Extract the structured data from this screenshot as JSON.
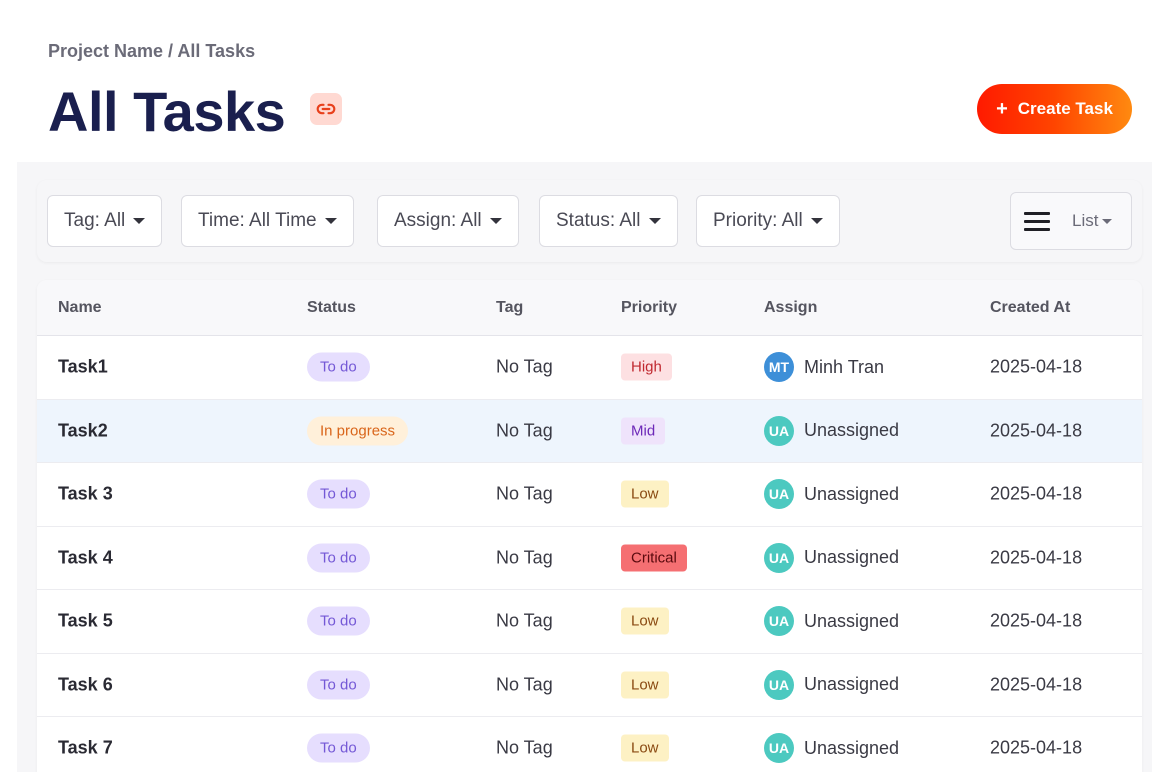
{
  "breadcrumb": "Project Name / All Tasks",
  "title": "All Tasks",
  "create_button": {
    "icon": "+",
    "label": "Create Task"
  },
  "colors": {
    "title": "#1a1f4e",
    "create_gradient_start": "#ff1a00",
    "create_gradient_end": "#ff8a10",
    "row_highlight": "#eef5fd"
  },
  "filters": [
    {
      "label": "Tag: All"
    },
    {
      "label": "Time: All Time"
    },
    {
      "label": "Assign: All"
    },
    {
      "label": "Status: All"
    },
    {
      "label": "Priority: All"
    }
  ],
  "view_toggle": {
    "icon": "hamburger-icon",
    "label": "List"
  },
  "table": {
    "headers": [
      "Name",
      "Status",
      "Tag",
      "Priority",
      "Assign",
      "Created At"
    ],
    "rows": [
      {
        "name": "Task1",
        "status": "To do",
        "tag": "No Tag",
        "priority": "High",
        "assign_initials": "MT",
        "assign_name": "Minh Tran",
        "created_at": "2025-04-18"
      },
      {
        "name": "Task2",
        "status": "In progress",
        "tag": "No Tag",
        "priority": "Mid",
        "assign_initials": "UA",
        "assign_name": "Unassigned",
        "created_at": "2025-04-18"
      },
      {
        "name": "Task 3",
        "status": "To do",
        "tag": "No Tag",
        "priority": "Low",
        "assign_initials": "UA",
        "assign_name": "Unassigned",
        "created_at": "2025-04-18"
      },
      {
        "name": "Task 4",
        "status": "To do",
        "tag": "No Tag",
        "priority": "Critical",
        "assign_initials": "UA",
        "assign_name": "Unassigned",
        "created_at": "2025-04-18"
      },
      {
        "name": "Task 5",
        "status": "To do",
        "tag": "No Tag",
        "priority": "Low",
        "assign_initials": "UA",
        "assign_name": "Unassigned",
        "created_at": "2025-04-18"
      },
      {
        "name": "Task 6",
        "status": "To do",
        "tag": "No Tag",
        "priority": "Low",
        "assign_initials": "UA",
        "assign_name": "Unassigned",
        "created_at": "2025-04-18"
      },
      {
        "name": "Task 7",
        "status": "To do",
        "tag": "No Tag",
        "priority": "Low",
        "assign_initials": "UA",
        "assign_name": "Unassigned",
        "created_at": "2025-04-18"
      }
    ]
  }
}
